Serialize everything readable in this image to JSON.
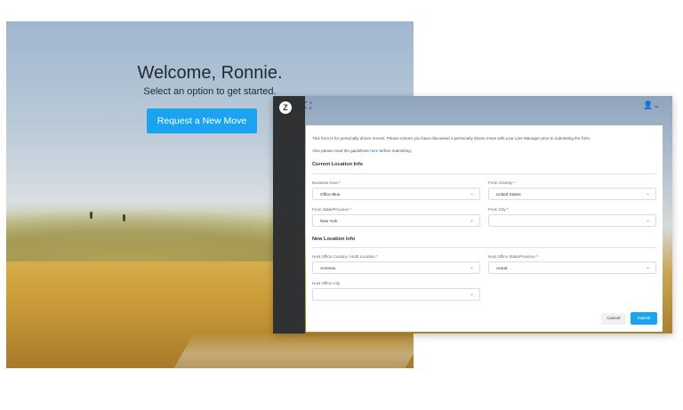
{
  "welcome": {
    "title": "Welcome, Ronnie.",
    "subtitle": "Select an option to get started.",
    "request_button": "Request a New Move"
  },
  "form_window": {
    "logo_glyph": "Z",
    "expand_icon": "⛶",
    "user_icon": "👤⌄",
    "note1": "This form is for personally driven moves. Please ensure you have discussed a personally driven move with your Line Manager prior to submitting the form.",
    "note2_prefix": "Also please read the guidelines ",
    "note2_link": "here",
    "note2_suffix": " before submitting.",
    "current_section": "Current Location Info",
    "new_section": "New Location Info",
    "fields": {
      "business_area": {
        "label": "Business Area",
        "value": "Office Blue"
      },
      "from_country": {
        "label": "From Country",
        "value": "United States"
      },
      "from_state": {
        "label": "From State/Province",
        "value": "New York"
      },
      "from_city": {
        "label": "From City",
        "value": ""
      },
      "host_country": {
        "label": "Host Office Country / HUB Location",
        "value": "Armenia"
      },
      "host_state": {
        "label": "Host Office State/Province",
        "value": "Ararat"
      },
      "host_city": {
        "label": "Host Office City",
        "value": ""
      }
    },
    "required_mark": "*",
    "chevron": "⌄",
    "cancel_button": "Cancel",
    "submit_button": "Submit"
  }
}
